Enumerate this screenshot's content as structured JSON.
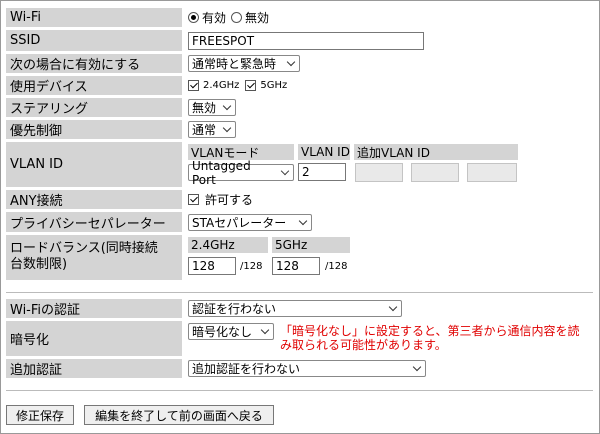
{
  "wifi": {
    "label": "Wi-Fi",
    "on": "有効",
    "off": "無効"
  },
  "ssid": {
    "label": "SSID",
    "value": "FREESPOT"
  },
  "enable_when": {
    "label": "次の場合に有効にする",
    "value": "通常時と緊急時"
  },
  "devices": {
    "label": "使用デバイス",
    "opt1": "2.4GHz",
    "opt2": "5GHz"
  },
  "steering": {
    "label": "ステアリング",
    "value": "無効"
  },
  "priority": {
    "label": "優先制御",
    "value": "通常"
  },
  "vlan": {
    "label": "VLAN ID",
    "mode_header": "VLANモード",
    "id_header": "VLAN ID",
    "add_header": "追加VLAN ID",
    "mode_value": "Untagged Port",
    "id_value": "2"
  },
  "any": {
    "label": "ANY接続",
    "allow": "許可する"
  },
  "privacy": {
    "label": "プライバシーセパレーター",
    "value": "STAセパレーター"
  },
  "loadbalance": {
    "label_line1": "ロードバランス(同時接続",
    "label_line2": "台数制限)",
    "h24": "2.4GHz",
    "h5": "5GHz",
    "v24": "128",
    "v5": "128",
    "max24": "/128",
    "max5": "/128"
  },
  "auth": {
    "label": "Wi-Fiの認証",
    "value": "認証を行わない"
  },
  "encryption": {
    "label": "暗号化",
    "value": "暗号化なし",
    "warning": "「暗号化なし」に設定すると、第三者から通信内容を読み取られる可能性があります。"
  },
  "extra_auth": {
    "label": "追加認証",
    "value": "追加認証を行わない"
  },
  "buttons": {
    "save": "修正保存",
    "back": "編集を終了して前の画面へ戻る"
  }
}
